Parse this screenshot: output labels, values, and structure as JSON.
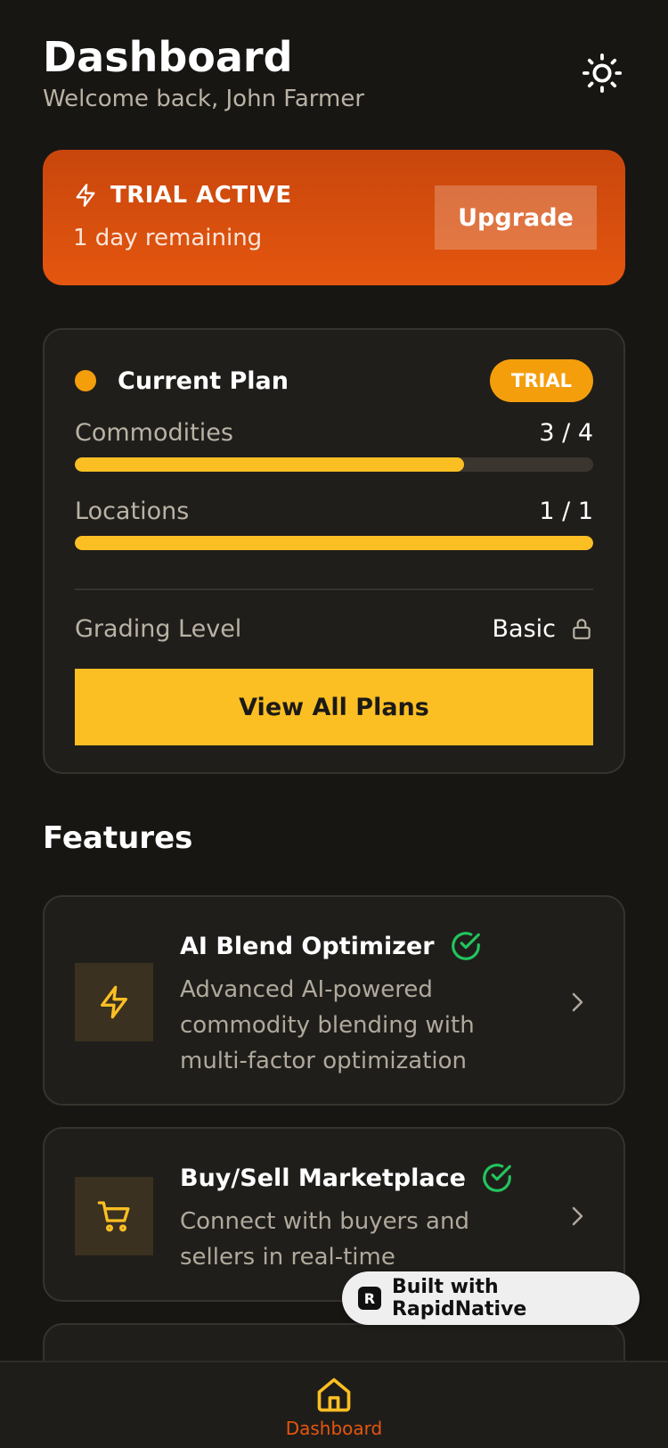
{
  "header": {
    "title": "Dashboard",
    "subtitle": "Welcome back, John Farmer",
    "theme_icon": "sun-icon"
  },
  "trial_banner": {
    "title": "TRIAL ACTIVE",
    "remaining": "1 day remaining",
    "upgrade_label": "Upgrade",
    "icon": "bolt-icon",
    "color": "#E4560F"
  },
  "plan": {
    "title": "Current Plan",
    "badge": "TRIAL",
    "usage": [
      {
        "label": "Commodities",
        "value": "3 / 4",
        "fraction": 0.75
      },
      {
        "label": "Locations",
        "value": "1 / 1",
        "fraction": 1.0
      }
    ],
    "grading_label": "Grading Level",
    "grading_value": "Basic",
    "view_plans_label": "View All Plans",
    "accent": "#FBBF24"
  },
  "features": {
    "title": "Features",
    "items": [
      {
        "title": "AI Blend Optimizer",
        "description": "Advanced AI-powered commodity blending with multi-factor optimization",
        "icon": "bolt-icon",
        "status": "check-circle-icon"
      },
      {
        "title": "Buy/Sell Marketplace",
        "description": "Connect with buyers and sellers in real-time",
        "icon": "cart-icon",
        "status": "check-circle-icon"
      }
    ]
  },
  "badge": {
    "label": "Built with RapidNative",
    "logo": "R"
  },
  "nav": {
    "dashboard_label": "Dashboard",
    "icon": "home-icon"
  }
}
